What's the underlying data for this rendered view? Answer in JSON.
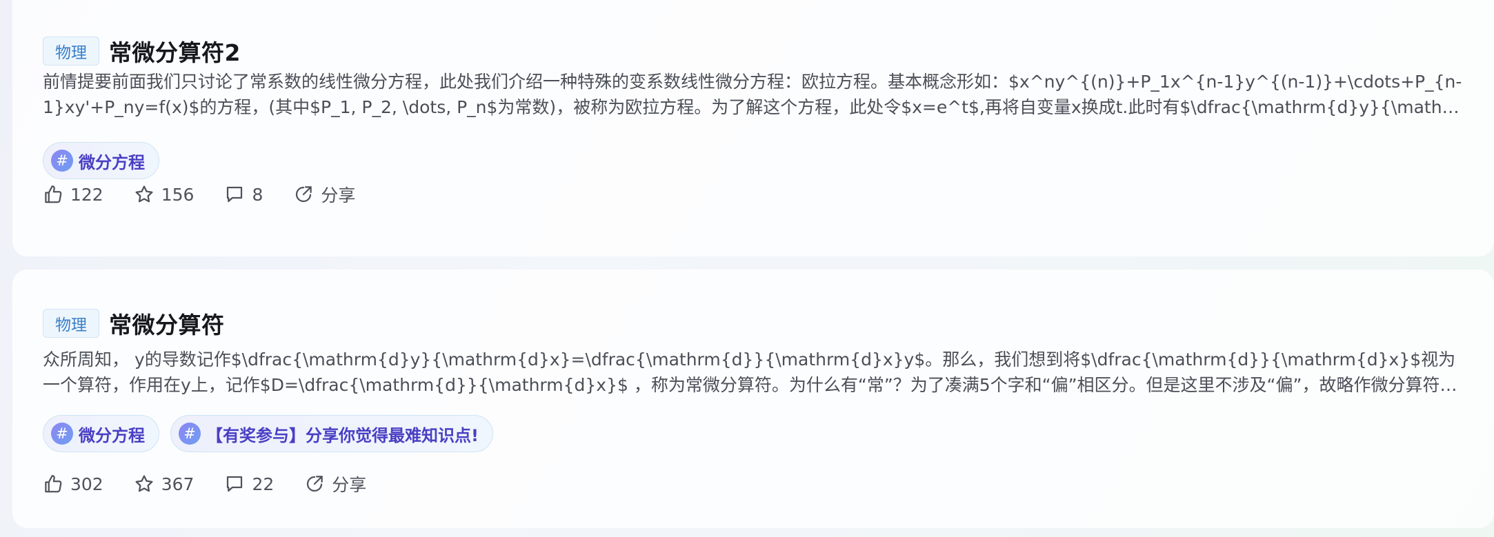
{
  "posts": [
    {
      "category": "物理",
      "title": "常微分算符2",
      "excerpt": "前情提要前面我们只讨论了常系数的线性微分方程，此处我们介绍一种特殊的变系数线性微分方程：欧拉方程。基本概念形如：$x^ny^{(n)}+P_1x^{n-1}y^{(n-1)}+\\cdots+P_{n-1}xy'+P_ny=f(x)$的方程，(其中$P_1, P_2, \\dots, P_n$为常数)，被称为欧拉方程。为了解这个方程，此处令$x=e^t$,再将自变量x换成t.此时有$\\dfrac{\\mathrm{d}y}{\\mathrm{d}x} = …",
      "tags": [
        "微分方程"
      ],
      "likes": "122",
      "favorites": "156",
      "comments": "8",
      "share_label": "分享"
    },
    {
      "category": "物理",
      "title": "常微分算符",
      "excerpt": "众所周知， y的导数记作$\\dfrac{\\mathrm{d}y}{\\mathrm{d}x}=\\dfrac{\\mathrm{d}}{\\mathrm{d}x}y$。那么，我们想到将$\\dfrac{\\mathrm{d}}{\\mathrm{d}x}$视为一个算符，作用在y上，记作$D=\\dfrac{\\mathrm{d}}{\\mathrm{d}x}$ ，称为常微分算符。为什么有“常”？为了凑满5个字和“偏”相区分。但是这里不涉及“偏”，故略作微分算符。自然而然，积分算符…",
      "tags": [
        "微分方程",
        "【有奖参与】分享你觉得最难知识点!"
      ],
      "likes": "302",
      "favorites": "367",
      "comments": "22",
      "share_label": "分享"
    }
  ],
  "icons": {
    "topic": "#"
  },
  "colors": {
    "category_text": "#3a7fc8",
    "topic_text": "#4a3fc4",
    "action_text": "#4e535b"
  }
}
